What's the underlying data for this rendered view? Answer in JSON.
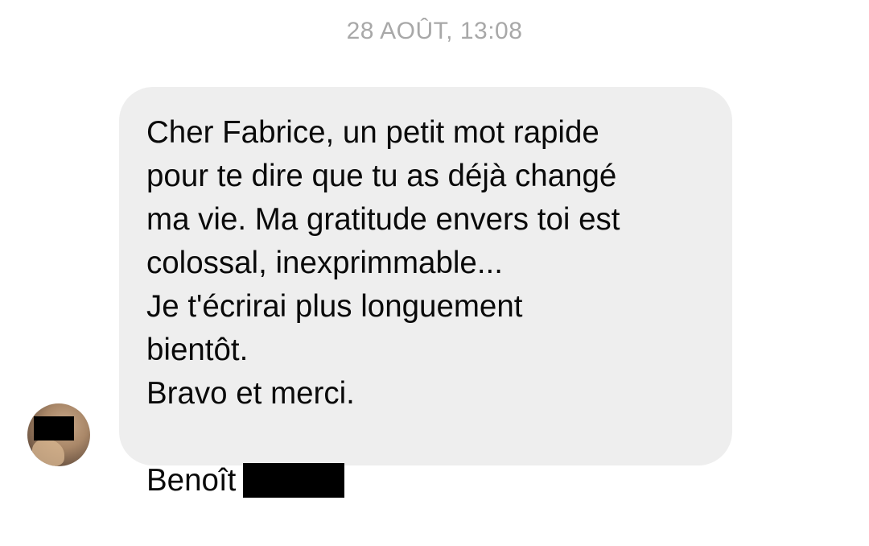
{
  "conversation": {
    "timestamp": "28 AOÛT, 13:08",
    "message": {
      "body": "Cher Fabrice, un petit mot rapide\npour te dire que tu as déjà changé\nma vie. Ma gratitude envers toi est\ncolossal, inexprimmable...\nJe t'écrirai plus longuement\nbientôt.\nBravo et merci.",
      "signature": "Benoît"
    }
  }
}
